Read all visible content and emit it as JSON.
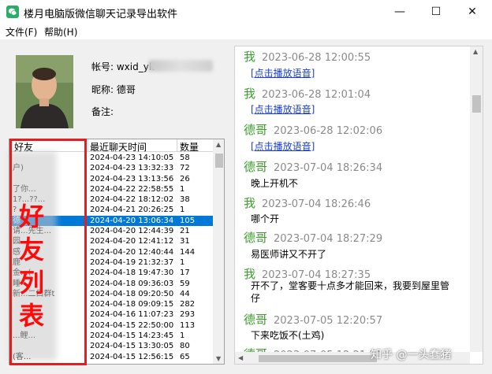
{
  "window": {
    "title": "楼月电脑版微信聊天记录导出软件",
    "min_glyph": "—",
    "max_glyph": "☐",
    "close_glyph": "✕"
  },
  "menu": {
    "file": "文件(F)",
    "help": "帮助(H)"
  },
  "profile": {
    "account_label": "帐号: wxid_yk",
    "nickname_label": "昵称: 德哥",
    "note_label": "备注:"
  },
  "friend_list": {
    "columns": [
      "好友",
      "最近聊天时间",
      "数量"
    ],
    "rows": [
      {
        "name": "",
        "time": "2024-04-23 14:10:05",
        "count": "58"
      },
      {
        "name": "户)",
        "time": "2024-04-23 13:32:33",
        "count": "72"
      },
      {
        "name": "",
        "time": "2024-04-23 13:13:56",
        "count": "26"
      },
      {
        "name": "了你...",
        "time": "2024-04-22 22:58:55",
        "count": "1"
      },
      {
        "name": "1?...??...",
        "time": "2024-04-22 18:12:02",
        "count": "38"
      },
      {
        "name": "?",
        "time": "2024-04-21 20:26:25",
        "count": "1"
      },
      {
        "name": "德",
        "time": "2024-04-20 13:06:34",
        "count": "105"
      },
      {
        "name": "请...先生...",
        "time": "2024-04-20 12:44:39",
        "count": "21"
      },
      {
        "name": "园",
        "time": "2024-04-20 12:41:12",
        "count": "31"
      },
      {
        "name": "感",
        "time": "2024-04-20 12:40:44",
        "count": "144"
      },
      {
        "name": "鹿",
        "time": "2024-04-19 21:32:37",
        "count": "1"
      },
      {
        "name": "金...(",
        "time": "2024-04-18 19:47:30",
        "count": "17"
      },
      {
        "name": "睡",
        "time": "2024-04-18 09:36:03",
        "count": "59"
      },
      {
        "name": "新...二口群t",
        "time": "2024-04-18 09:20:50",
        "count": "44"
      },
      {
        "name": "",
        "time": "2024-04-18 09:09:15",
        "count": "282"
      },
      {
        "name": "",
        "time": "2024-04-16 11:07:23",
        "count": "293"
      },
      {
        "name": "",
        "time": "2024-04-15 22:50:00",
        "count": "113"
      },
      {
        "name": "...鲤...",
        "time": "2024-04-15 14:23:45",
        "count": "1"
      },
      {
        "name": "",
        "time": "2024-04-15 13:30:05",
        "count": "80"
      },
      {
        "name": "(客...",
        "time": "2024-04-15 12:56:15",
        "count": "65"
      }
    ]
  },
  "annotation": {
    "chars": [
      "好",
      "友",
      "列",
      "表"
    ]
  },
  "chat": {
    "messages": [
      {
        "sender": "我",
        "time": "2023-06-28 12:00:55",
        "body": "[点击播放语音]",
        "link": true
      },
      {
        "sender": "我",
        "time": "2023-06-28 12:01:04",
        "body": "[点击播放语音]",
        "link": true
      },
      {
        "sender": "德哥",
        "time": "2023-06-28 12:02:06",
        "body": "[点击播放语音]",
        "link": true
      },
      {
        "sender": "德哥",
        "time": "2023-07-04 18:26:34",
        "body": "晚上开机不",
        "link": false
      },
      {
        "sender": "我",
        "time": "2023-07-04 18:26:46",
        "body": "哪个开",
        "link": false
      },
      {
        "sender": "德哥",
        "time": "2023-07-04 18:27:29",
        "body": "易医师讲又不开了",
        "link": false
      },
      {
        "sender": "我",
        "time": "2023-07-04 18:27:35",
        "body": "开不了，堂客要十点多才能回来，我要到屋里管仔",
        "link": false
      },
      {
        "sender": "德哥",
        "time": "2023-07-05 12:20:57",
        "body": "下来吃饭不(土鸡)",
        "link": false
      },
      {
        "sender": "德哥",
        "time": "2023-07-05 12:21:21",
        "body": "",
        "link": false
      }
    ]
  },
  "watermark": "知乎 @一头蠢猪"
}
